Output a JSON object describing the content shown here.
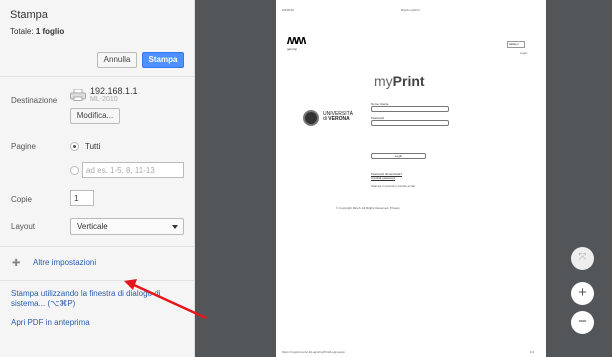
{
  "dialog": {
    "title": "Stampa",
    "total_label": "Totale:",
    "total_value": "1 foglio",
    "cancel_label": "Annulla",
    "print_label": "Stampa"
  },
  "destination": {
    "label": "Destinazione",
    "printer_name": "192.168.1.1",
    "printer_model": "ML-2010",
    "modify_label": "Modifica..."
  },
  "pages": {
    "label": "Pagine",
    "all_label": "Tutti",
    "range_placeholder": "ad es. 1-5, 8, 11-13"
  },
  "copies": {
    "label": "Copie",
    "value": "1"
  },
  "layout": {
    "label": "Layout",
    "selected": "Verticale"
  },
  "more_settings_label": "Altre impostazioni",
  "links": {
    "system_dialog": "Stampa utilizzando la finestra di dialogo di sistema... (⌥⌘P)",
    "open_pdf": "Apri PDF in anteprima"
  },
  "preview": {
    "header_date": "9/4/2019",
    "header_title": "Ricoh myPrint",
    "logo_text": "gammp",
    "logo_sub": "gammp",
    "language": "Italiano",
    "language_sub": "Login",
    "app_name_light": "my",
    "app_name_bold": "Print",
    "university_line1": "UNIVERSITÀ",
    "university_line2_prefix": "di",
    "university_line2": "VERONA",
    "username_label": "Nome Utente",
    "password_label": "Password",
    "login_label": "Login",
    "forgot_password": "Password dimenticata?",
    "change_password": "Cambia password",
    "print_without_login": "Stampa in anonimo tramite email",
    "copyright": "© Copyright Ricoh. All Rights Reserved. Privacy",
    "footer_url": "https://myprint.univr.it/Login/myPrint/Login.aspx",
    "footer_page": "1/1"
  },
  "zoom": {
    "fit_icon": "fit-to-page-icon",
    "zoom_in_symbol": "+",
    "zoom_out_symbol": "−"
  },
  "annotation": {
    "arrow_color": "#e8161b"
  }
}
